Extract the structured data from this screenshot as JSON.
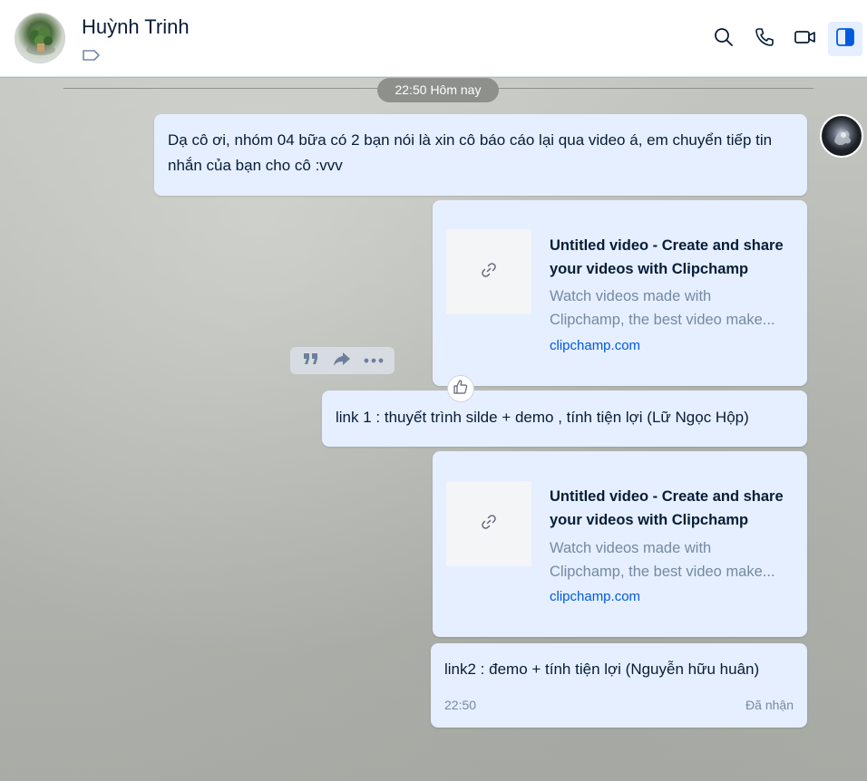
{
  "header": {
    "contact_name": "Huỳnh Trinh",
    "icons": [
      "tag-icon",
      "search-icon",
      "phone-icon",
      "video-call-icon",
      "sidebar-toggle-icon"
    ]
  },
  "chat": {
    "time_divider": "22:50 Hôm nay",
    "messages": [
      {
        "type": "text",
        "text": "Dạ cô ơi, nhóm 04 bữa có 2 bạn nói là xin cô báo cáo lại qua video á, em chuyển tiếp tin nhắn của bạn cho cô :vvv"
      },
      {
        "type": "link",
        "title": "Untitled video - Create and share your videos with Clipchamp",
        "description_line1": "Watch videos made with",
        "description_line2": "Clipchamp, the best video make...",
        "domain": "clipchamp.com"
      },
      {
        "type": "text",
        "text": "link 1 : thuyết trình silde + demo , tính tiện lợi (Lữ Ngọc Hộp)"
      },
      {
        "type": "link",
        "title": "Untitled video - Create and share your videos with Clipchamp",
        "description_line1": "Watch videos made with",
        "description_line2": "Clipchamp, the best video make...",
        "domain": "clipchamp.com"
      },
      {
        "type": "text",
        "text": "link2 : đemo + tính tiện lợi (Nguyễn hữu huân)",
        "time": "22:50",
        "status": "Đã nhận"
      }
    ],
    "toolbar_icons": [
      "quote-icon",
      "forward-icon",
      "more-icon"
    ],
    "reaction_icon": "thumbs-up-icon"
  },
  "colors": {
    "bubble": "#e5efff",
    "accent": "#005ae0",
    "text": "#081c36",
    "muted": "#7589a3"
  }
}
